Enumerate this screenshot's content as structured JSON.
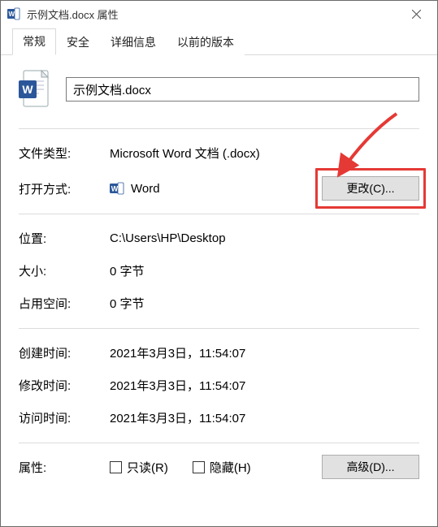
{
  "window": {
    "title": "示例文档.docx 属性"
  },
  "tabs": {
    "general": "常规",
    "security": "安全",
    "details": "详细信息",
    "previous": "以前的版本"
  },
  "file": {
    "name": "示例文档.docx"
  },
  "labels": {
    "filetype": "文件类型:",
    "opens_with": "打开方式:",
    "location": "位置:",
    "size": "大小:",
    "size_on_disk": "占用空间:",
    "created": "创建时间:",
    "modified": "修改时间:",
    "accessed": "访问时间:",
    "attributes": "属性:"
  },
  "values": {
    "filetype": "Microsoft Word 文档 (.docx)",
    "opens_with": "Word",
    "location": "C:\\Users\\HP\\Desktop",
    "size": "0 字节",
    "size_on_disk": "0 字节",
    "created": "2021年3月3日，11:54:07",
    "modified": "2021年3月3日，11:54:07",
    "accessed": "2021年3月3日，11:54:07"
  },
  "buttons": {
    "change": "更改(C)...",
    "advanced": "高级(D)..."
  },
  "checkboxes": {
    "readonly": "只读(R)",
    "hidden": "隐藏(H)"
  },
  "colors": {
    "highlight": "#e53935",
    "word_blue": "#2b579a"
  }
}
